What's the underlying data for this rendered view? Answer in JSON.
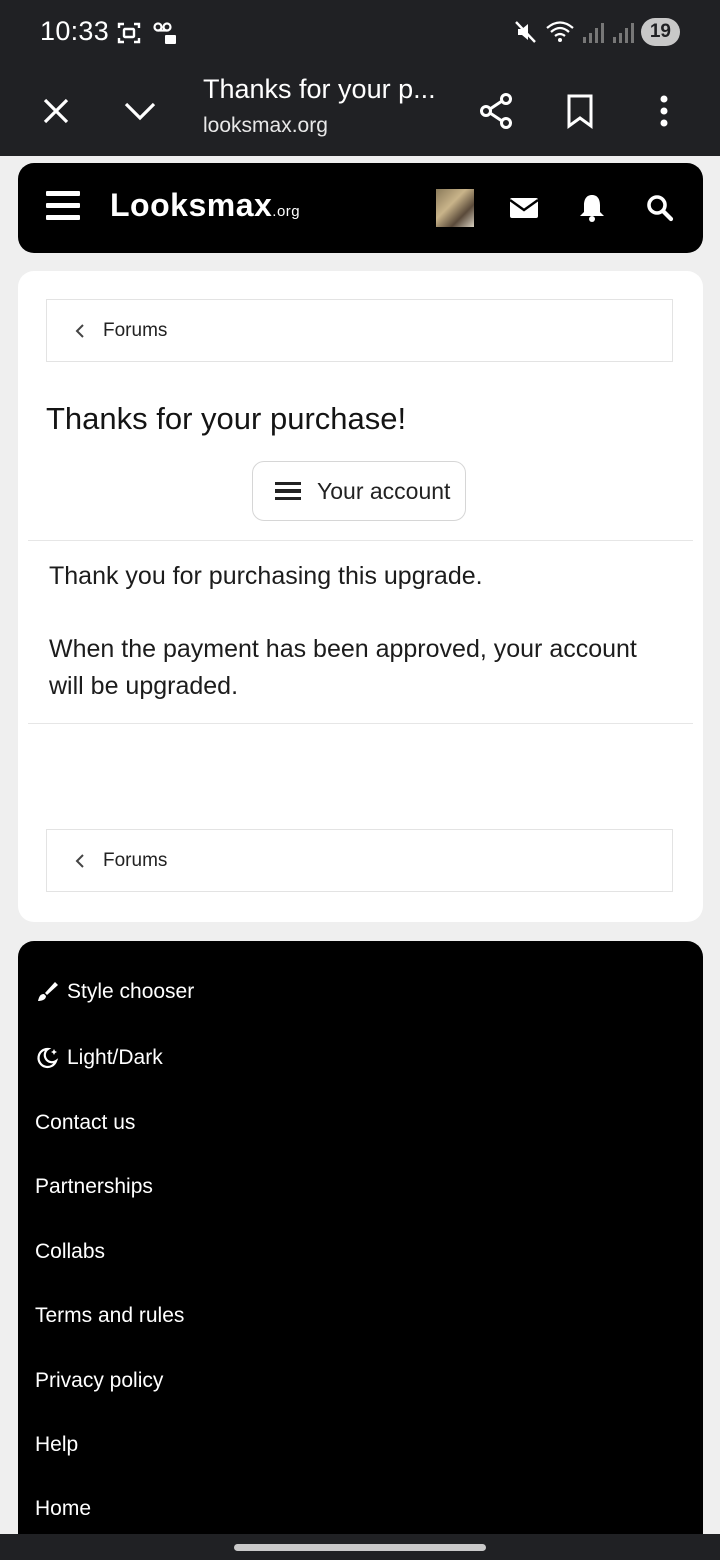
{
  "status_bar": {
    "time": "10:33",
    "battery": "19"
  },
  "browser": {
    "title": "Thanks for your p...",
    "url": "looksmax.org"
  },
  "site_header": {
    "logo": "Looksmax",
    "logo_suffix": ".org"
  },
  "breadcrumb_top": {
    "label": "Forums"
  },
  "page_title": "Thanks for your purchase!",
  "account_button": {
    "label": "Your account"
  },
  "message": {
    "line1": "Thank you for purchasing this upgrade.",
    "line2": "When the payment has been approved, your account will be upgraded."
  },
  "breadcrumb_bottom": {
    "label": "Forums"
  },
  "footer": {
    "items": [
      {
        "label": "Style chooser",
        "icon": "paintbrush-icon"
      },
      {
        "label": "Light/Dark",
        "icon": "moon-icon"
      },
      {
        "label": "Contact us"
      },
      {
        "label": "Partnerships"
      },
      {
        "label": "Collabs"
      },
      {
        "label": "Terms and rules"
      },
      {
        "label": "Privacy policy"
      },
      {
        "label": "Help"
      },
      {
        "label": "Home"
      }
    ]
  }
}
